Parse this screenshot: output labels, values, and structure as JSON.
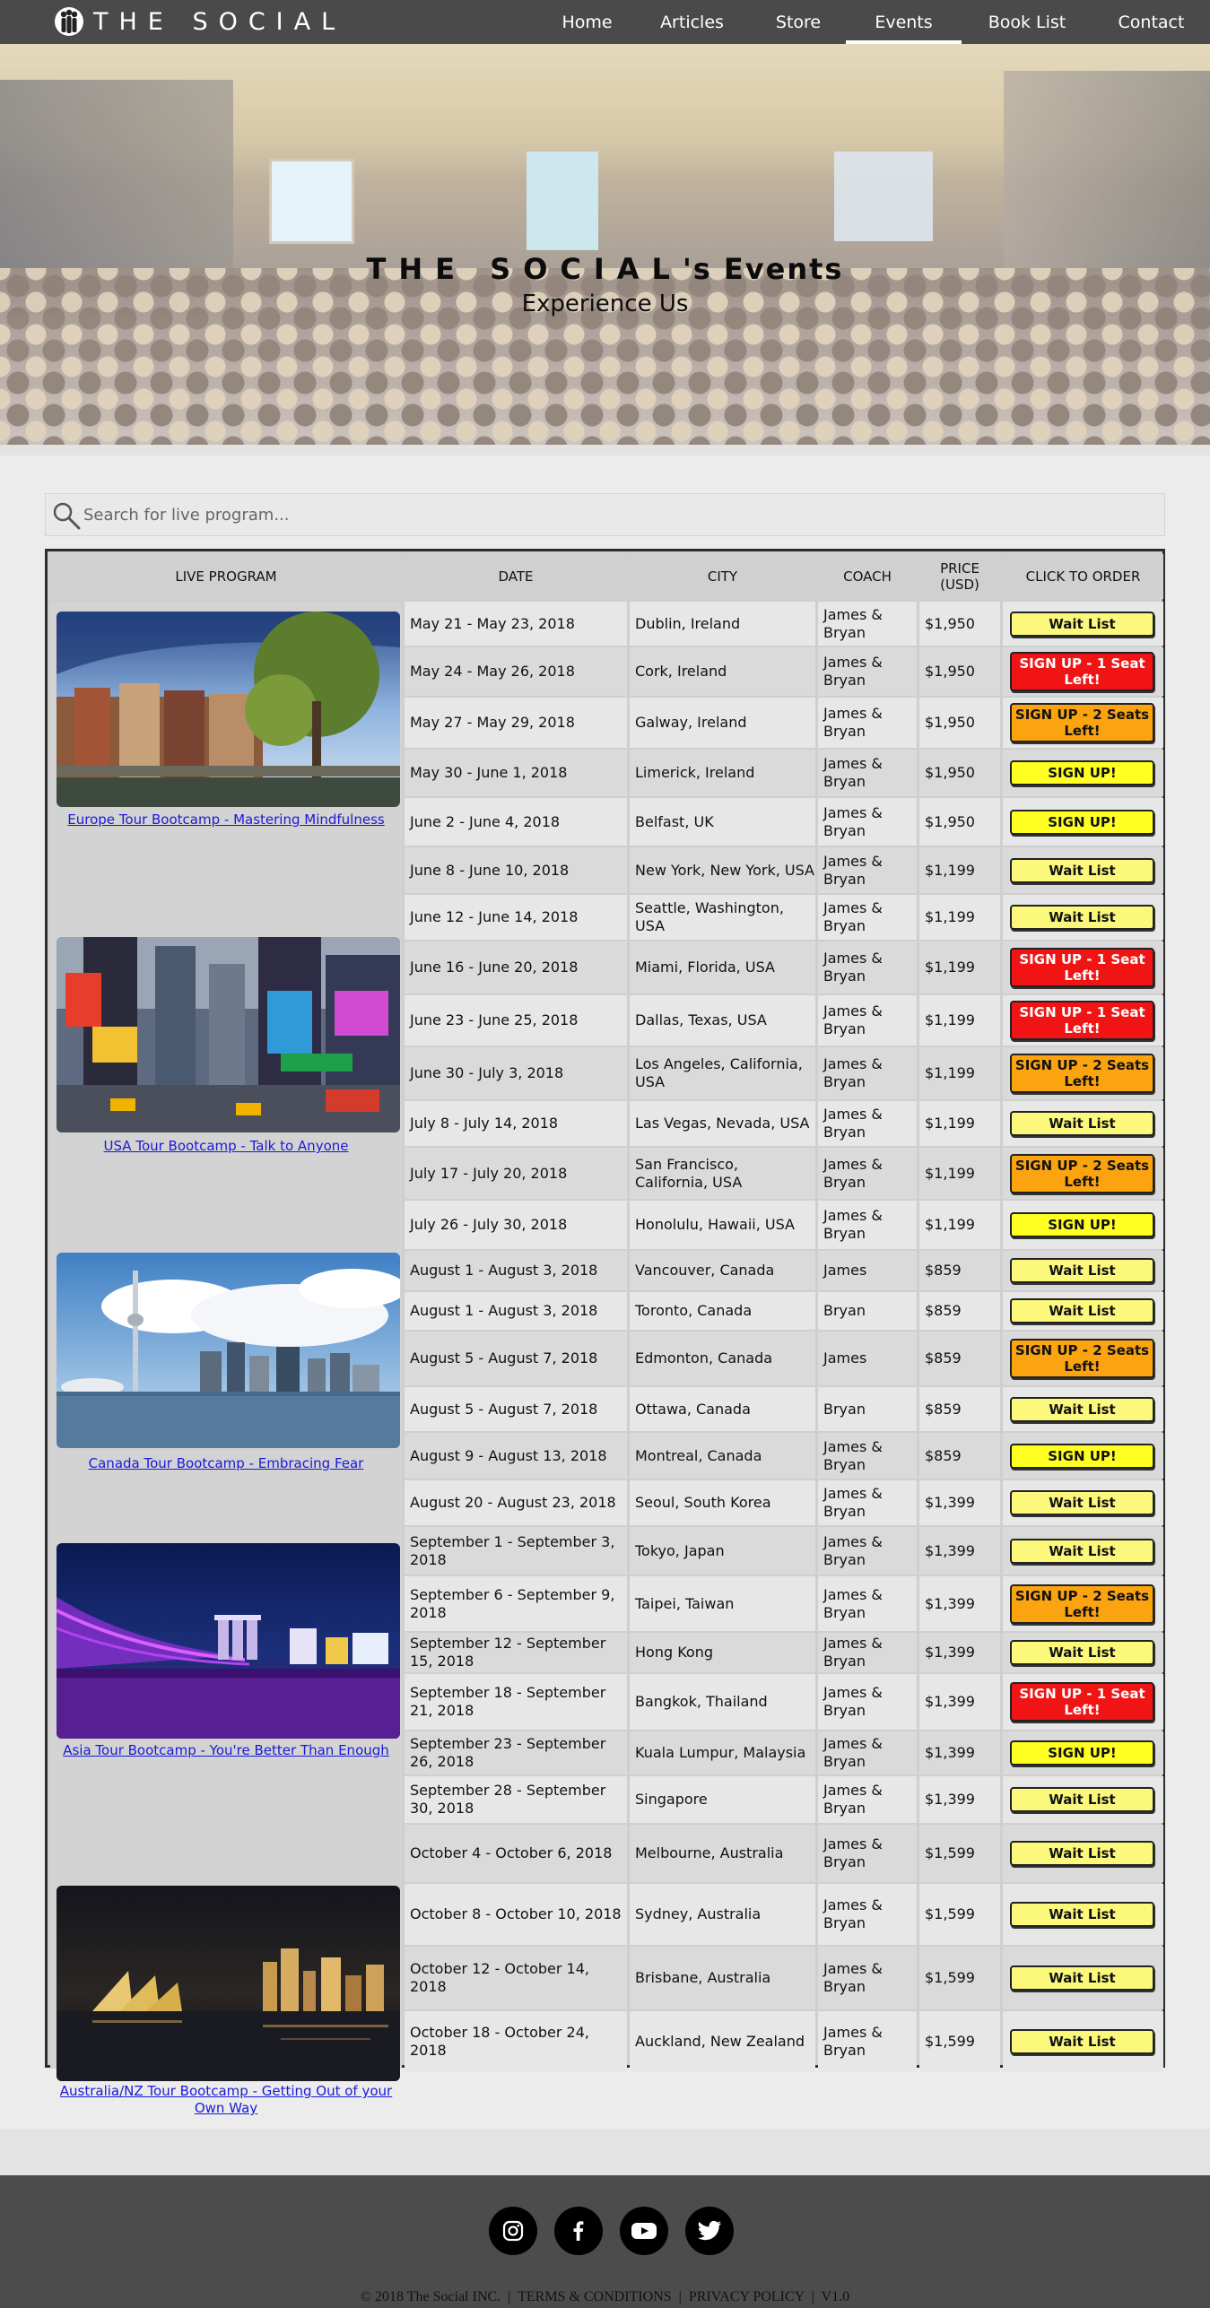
{
  "brand": {
    "name": "THE SOCIAL"
  },
  "nav": [
    {
      "label": "Home",
      "active": false
    },
    {
      "label": "Articles",
      "active": false
    },
    {
      "label": "Store",
      "active": false
    },
    {
      "label": "Events",
      "active": true
    },
    {
      "label": "Book List",
      "active": false
    },
    {
      "label": "Contact",
      "active": false
    }
  ],
  "hero": {
    "title_brand": "THE SOCIAL",
    "title_suffix": "'s Events",
    "subtitle": "Experience Us"
  },
  "search": {
    "placeholder": "Search for live program..."
  },
  "table": {
    "headers": [
      "LIVE PROGRAM",
      "DATE",
      "CITY",
      "COACH",
      "PRICE (USD)",
      "CLICK TO ORDER"
    ],
    "programs": [
      {
        "name": "Europe Tour Bootcamp - Mastering Mindfulness",
        "image": "amsterdam-canal-photo"
      },
      {
        "name": "USA Tour Bootcamp - Talk to Anyone",
        "image": "times-square-photo"
      },
      {
        "name": "Canada Tour Bootcamp - Embracing Fear",
        "image": "toronto-skyline-photo"
      },
      {
        "name": "Asia Tour Bootcamp - You're Better Than Enough",
        "image": "marina-bay-night-photo"
      },
      {
        "name": "Australia/NZ Tour Bootcamp - Getting Out of your Own Way",
        "image": "sydney-harbour-night-photo"
      }
    ],
    "rows": [
      {
        "date": "May 21 - May 23, 2018",
        "city": "Dublin, Ireland",
        "coach": "James & Bryan",
        "price": "$1,950",
        "order": "Wait List",
        "kind": "wait"
      },
      {
        "date": "May 24 - May 26, 2018",
        "city": "Cork, Ireland",
        "coach": "James & Bryan",
        "price": "$1,950",
        "order": "SIGN UP - 1 Seat Left!",
        "kind": "one"
      },
      {
        "date": "May 27 - May 29, 2018",
        "city": "Galway, Ireland",
        "coach": "James & Bryan",
        "price": "$1,950",
        "order": "SIGN UP - 2 Seats Left!",
        "kind": "two"
      },
      {
        "date": "May 30 - June 1, 2018",
        "city": "Limerick, Ireland",
        "coach": "James & Bryan",
        "price": "$1,950",
        "order": "SIGN UP!",
        "kind": "signup"
      },
      {
        "date": "June 2 - June 4, 2018",
        "city": "Belfast, UK",
        "coach": "James & Bryan",
        "price": "$1,950",
        "order": "SIGN UP!",
        "kind": "signup"
      },
      {
        "date": "June 8 - June 10, 2018",
        "city": "New York, New York, USA",
        "coach": "James & Bryan",
        "price": "$1,199",
        "order": "Wait List",
        "kind": "wait"
      },
      {
        "date": "June 12 - June 14, 2018",
        "city": "Seattle, Washington, USA",
        "coach": "James & Bryan",
        "price": "$1,199",
        "order": "Wait List",
        "kind": "wait"
      },
      {
        "date": "June 16 - June 20, 2018",
        "city": "Miami, Florida, USA",
        "coach": "James & Bryan",
        "price": "$1,199",
        "order": "SIGN UP - 1 Seat Left!",
        "kind": "one"
      },
      {
        "date": "June 23 - June 25, 2018",
        "city": "Dallas, Texas, USA",
        "coach": "James & Bryan",
        "price": "$1,199",
        "order": "SIGN UP - 1 Seat Left!",
        "kind": "one"
      },
      {
        "date": "June 30 - July 3, 2018",
        "city": "Los Angeles, California, USA",
        "coach": "James & Bryan",
        "price": "$1,199",
        "order": "SIGN UP - 2 Seats Left!",
        "kind": "two"
      },
      {
        "date": "July 8 - July 14, 2018",
        "city": "Las Vegas, Nevada, USA",
        "coach": "James & Bryan",
        "price": "$1,199",
        "order": "Wait List",
        "kind": "wait"
      },
      {
        "date": "July 17 - July 20, 2018",
        "city": "San Francisco, California, USA",
        "coach": "James & Bryan",
        "price": "$1,199",
        "order": "SIGN UP - 2 Seats Left!",
        "kind": "two"
      },
      {
        "date": "July 26 - July 30, 2018",
        "city": "Honolulu, Hawaii, USA",
        "coach": "James & Bryan",
        "price": "$1,199",
        "order": "SIGN UP!",
        "kind": "signup"
      },
      {
        "date": "August 1 - August 3, 2018",
        "city": "Vancouver, Canada",
        "coach": "James",
        "price": "$859",
        "order": "Wait List",
        "kind": "wait"
      },
      {
        "date": "August 1 - August 3, 2018",
        "city": "Toronto, Canada",
        "coach": "Bryan",
        "price": "$859",
        "order": "Wait List",
        "kind": "wait"
      },
      {
        "date": "August 5 - August 7, 2018",
        "city": "Edmonton, Canada",
        "coach": "James",
        "price": "$859",
        "order": "SIGN UP - 2 Seats Left!",
        "kind": "two"
      },
      {
        "date": "August 5 - August 7, 2018",
        "city": "Ottawa, Canada",
        "coach": "Bryan",
        "price": "$859",
        "order": "Wait List",
        "kind": "wait"
      },
      {
        "date": "August 9 - August 13, 2018",
        "city": "Montreal, Canada",
        "coach": "James & Bryan",
        "price": "$859",
        "order": "SIGN UP!",
        "kind": "signup"
      },
      {
        "date": "August 20 - August 23, 2018",
        "city": "Seoul, South Korea",
        "coach": "James & Bryan",
        "price": "$1,399",
        "order": "Wait List",
        "kind": "wait"
      },
      {
        "date": "September 1 - September 3, 2018",
        "city": "Tokyo, Japan",
        "coach": "James & Bryan",
        "price": "$1,399",
        "order": "Wait List",
        "kind": "wait"
      },
      {
        "date": "September 6 - September 9, 2018",
        "city": "Taipei, Taiwan",
        "coach": "James & Bryan",
        "price": "$1,399",
        "order": "SIGN UP - 2 Seats Left!",
        "kind": "two"
      },
      {
        "date": "September 12 - September 15, 2018",
        "city": "Hong Kong",
        "coach": "James & Bryan",
        "price": "$1,399",
        "order": "Wait List",
        "kind": "wait"
      },
      {
        "date": "September 18 - September 21, 2018",
        "city": "Bangkok, Thailand",
        "coach": "James & Bryan",
        "price": "$1,399",
        "order": "SIGN UP - 1 Seat Left!",
        "kind": "one"
      },
      {
        "date": "September 23 - September 26, 2018",
        "city": "Kuala Lumpur, Malaysia",
        "coach": "James & Bryan",
        "price": "$1,399",
        "order": "SIGN UP!",
        "kind": "signup"
      },
      {
        "date": "September 28 - September 30, 2018",
        "city": "Singapore",
        "coach": "James & Bryan",
        "price": "$1,399",
        "order": "Wait List",
        "kind": "wait"
      },
      {
        "date": "October 4 - October 6, 2018",
        "city": "Melbourne, Australia",
        "coach": "James & Bryan",
        "price": "$1,599",
        "order": "Wait List",
        "kind": "wait"
      },
      {
        "date": "October 8 - October 10, 2018",
        "city": "Sydney, Australia",
        "coach": "James & Bryan",
        "price": "$1,599",
        "order": "Wait List",
        "kind": "wait"
      },
      {
        "date": "October 12 - October 14, 2018",
        "city": "Brisbane, Australia",
        "coach": "James & Bryan",
        "price": "$1,599",
        "order": "Wait List",
        "kind": "wait"
      },
      {
        "date": "October 18 - October 24, 2018",
        "city": "Auckland, New Zealand",
        "coach": "James & Bryan",
        "price": "$1,599",
        "order": "Wait List",
        "kind": "wait"
      }
    ]
  },
  "footer": {
    "social": [
      "instagram-icon",
      "facebook-icon",
      "youtube-icon",
      "twitter-icon"
    ],
    "copyright": "© 2018 The Social INC.",
    "terms": "TERMS & CONDITIONS",
    "privacy": "PRIVACY POLICY",
    "version": "V1.0",
    "separator": "|"
  },
  "colors": {
    "wait": "#fbf87b",
    "signup": "#ffff22",
    "one_seat": "#f01414",
    "two_seats": "#fba40f",
    "nav": "#4a4a4a"
  }
}
